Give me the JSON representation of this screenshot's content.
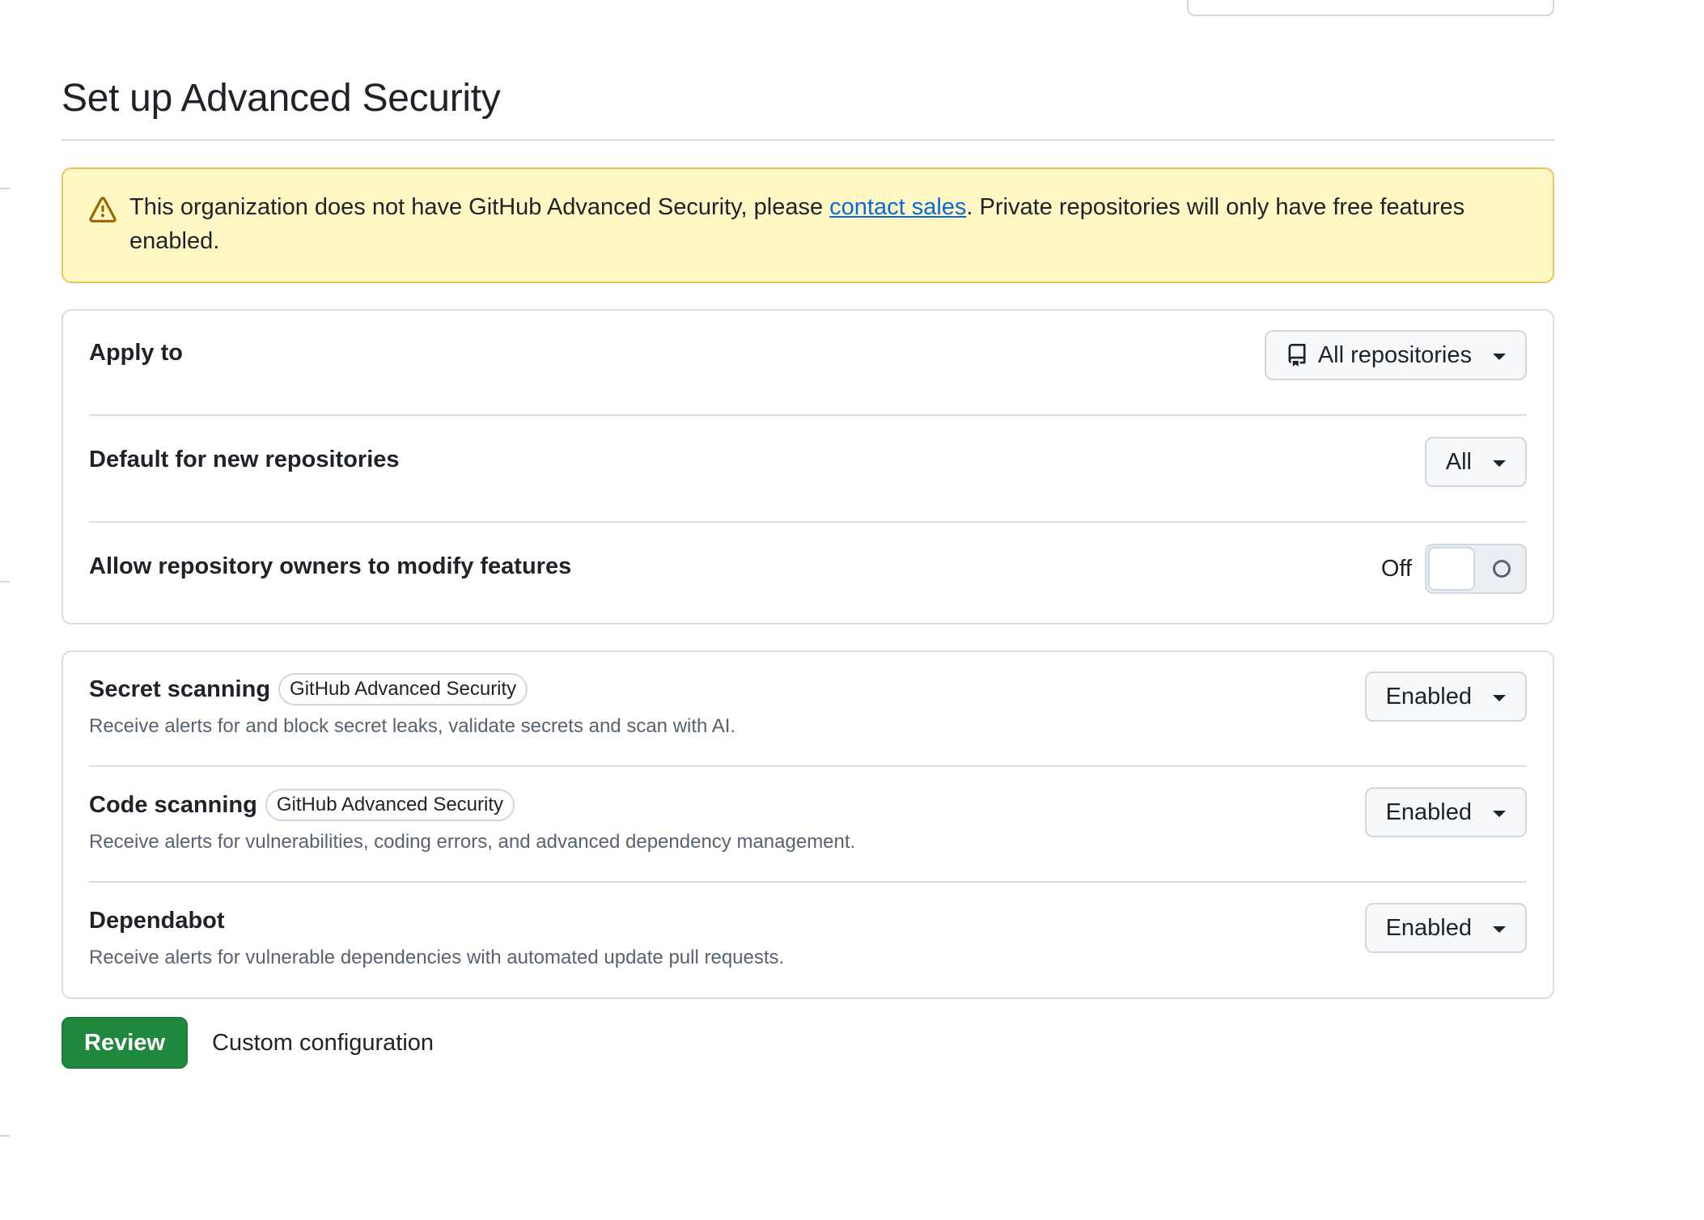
{
  "page": {
    "title": "Set up Advanced Security"
  },
  "flash": {
    "icon": "alert-icon",
    "text_before": "This organization does not have GitHub Advanced Security, please ",
    "link_text": "contact sales",
    "text_after": ". Private repositories will only have free features enabled."
  },
  "settings": {
    "apply_to": {
      "label": "Apply to",
      "value": "All repositories",
      "icon": "repo-icon"
    },
    "default_new": {
      "label": "Default for new repositories",
      "value": "All"
    },
    "allow_modify": {
      "label": "Allow repository owners to modify features",
      "state_label": "Off",
      "enabled": false
    }
  },
  "features": [
    {
      "name": "Secret scanning",
      "badge": "GitHub Advanced Security",
      "description": "Receive alerts for and block secret leaks, validate secrets and scan with AI.",
      "status": "Enabled"
    },
    {
      "name": "Code scanning",
      "badge": "GitHub Advanced Security",
      "description": "Receive alerts for vulnerabilities, coding errors, and advanced dependency management.",
      "status": "Enabled"
    },
    {
      "name": "Dependabot",
      "badge": "",
      "description": "Receive alerts for vulnerable dependencies with automated update pull requests.",
      "status": "Enabled"
    }
  ],
  "actions": {
    "review_label": "Review",
    "custom_label": "Custom configuration"
  },
  "colors": {
    "flash_bg": "#fff8c5",
    "flash_border": "#e9c55b",
    "link": "#0969da",
    "primary": "#1f883d"
  }
}
